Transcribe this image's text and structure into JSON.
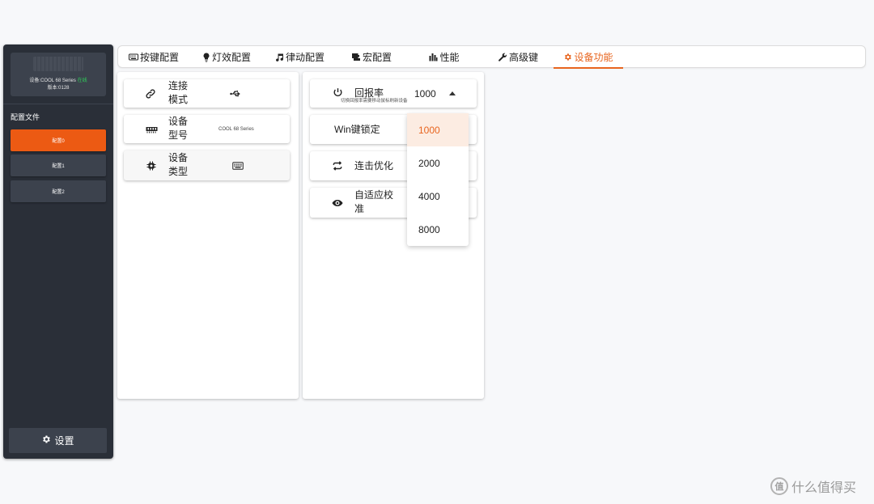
{
  "sidebar": {
    "device_label": "设备:COOL 68 Series",
    "online_label": "在线",
    "version_label": "版本:0128",
    "profiles_title": "配置文件",
    "profiles": [
      "配置0",
      "配置1",
      "配置2"
    ],
    "active_profile": "配置0",
    "settings_label": "设置"
  },
  "tabs": [
    {
      "label": "按键配置",
      "icon": "keyboard-icon"
    },
    {
      "label": "灯效配置",
      "icon": "bulb-icon"
    },
    {
      "label": "律动配置",
      "icon": "music-note-icon"
    },
    {
      "label": "宏配置",
      "icon": "macro-icon"
    },
    {
      "label": "性能",
      "icon": "bar-chart-icon"
    },
    {
      "label": "高级键",
      "icon": "wrench-icon"
    },
    {
      "label": "设备功能",
      "icon": "gear-icon"
    }
  ],
  "active_tab": "设备功能",
  "device_info": {
    "connection_label": "连接模式",
    "connection_icon": "usb-icon",
    "model_label": "设备型号",
    "model_value": "COOL 68 Series",
    "type_label": "设备类型",
    "type_icon": "keyboard-icon"
  },
  "functions": {
    "polling_label": "回报率",
    "polling_value": "1000",
    "polling_hint": "切换回报率需要移动鼠标刷新设备",
    "win_lock_label": "Win键锁定",
    "rapid_label": "连击优化",
    "adaptive_label": "自适应校准"
  },
  "polling_options": [
    "1000",
    "2000",
    "4000",
    "8000"
  ],
  "selected_polling": "1000",
  "watermark": "什么值得买",
  "colors": {
    "accent": "#e8651f",
    "sidebar_bg": "#2a2f38",
    "profile_active": "#ec5a13",
    "online": "#2fd05a"
  }
}
